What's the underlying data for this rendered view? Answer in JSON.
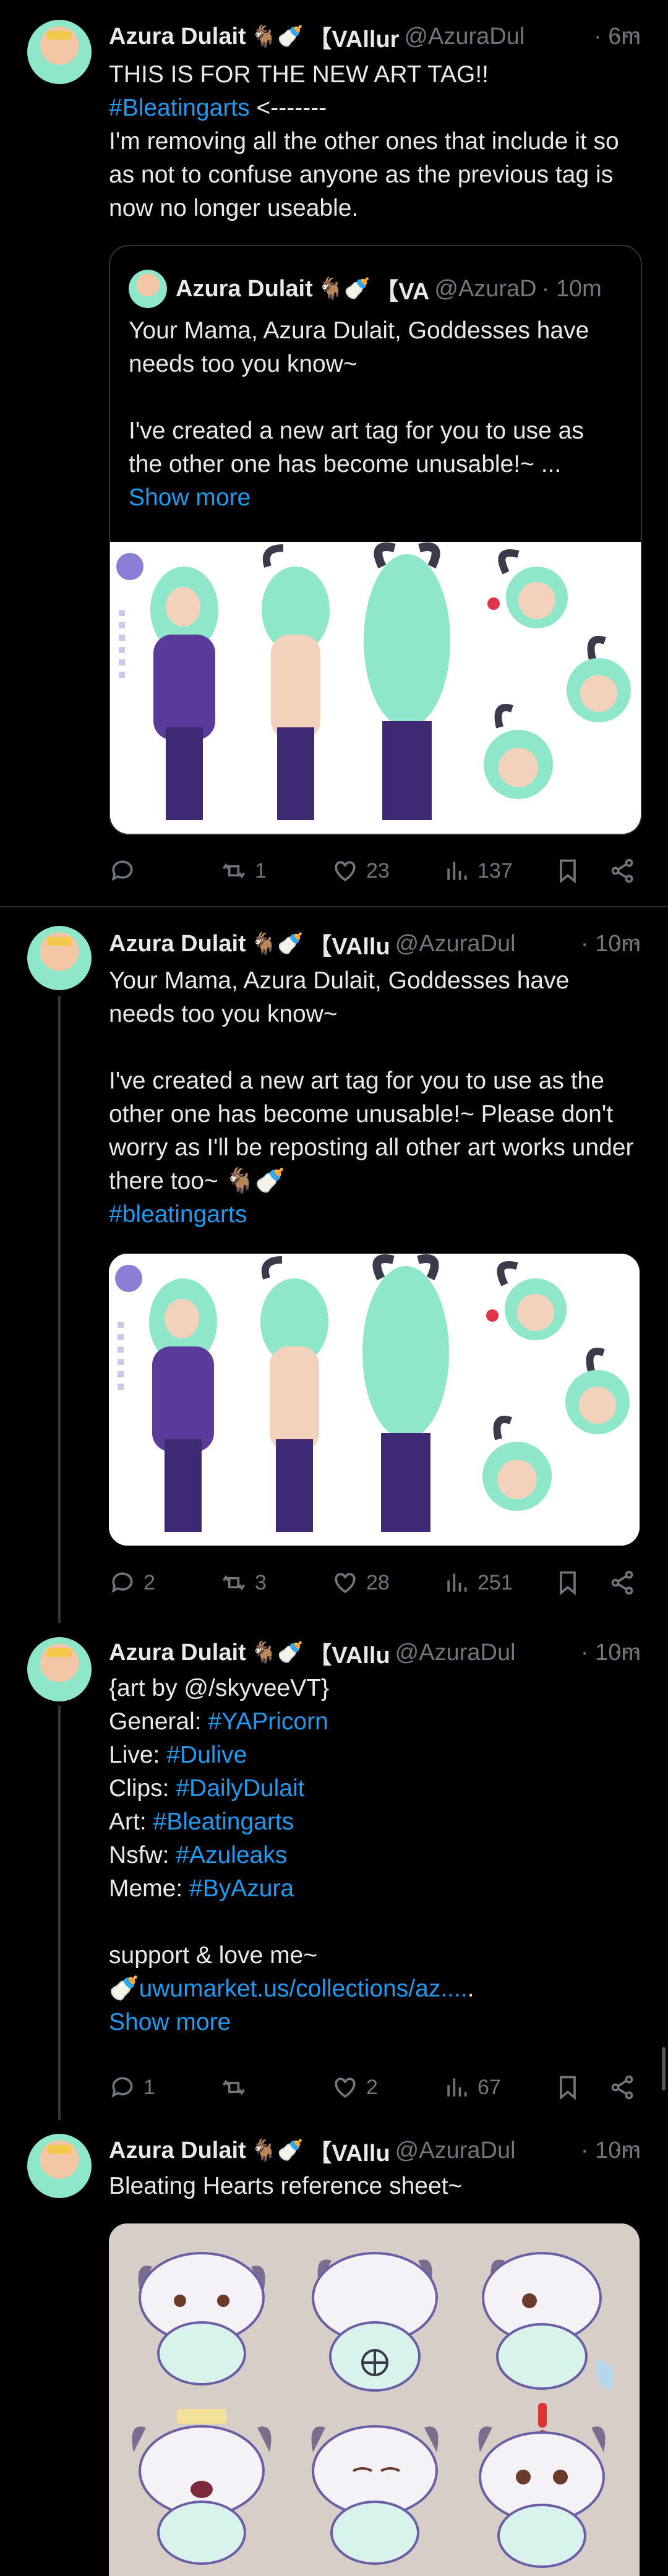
{
  "tweets": [
    {
      "name": "Azura Dulait",
      "emoji": "🐐🍼",
      "tag": "【VAllur",
      "handle": "@AzuraDul",
      "time": "· 6m",
      "lines": [
        "THIS IS FOR THE NEW ART TAG!!"
      ],
      "hashtag": "#Bleatingarts",
      "after_hashtag": " <-------",
      "body": "I'm removing all the other ones that include it so as not to confuse anyone as the previous tag is now no longer useable.",
      "quote": {
        "name": "Azura Dulait",
        "emoji": "🐐🍼",
        "tag": "【VA",
        "handle": "@AzuraD",
        "time": "· 10m",
        "text1": "Your Mama, Azura Dulait, Goddesses have needs too you know~",
        "text2": "I've created a new art tag for you to use as the other one has become unusable!~ ...",
        "show_more": "Show more"
      },
      "stats": {
        "replies": "",
        "retweets": "1",
        "likes": "23",
        "views": "137"
      }
    },
    {
      "name": "Azura Dulait",
      "emoji": "🐐🍼",
      "tag": "【VAllu",
      "handle": "@AzuraDul",
      "time": "· 10m",
      "text1": "Your Mama, Azura Dulait, Goddesses have needs too you know~",
      "text2": "I've created a new art tag for you to use as the other one has become unusable!~ Please don't worry as I'll be reposting all other art works under there too~ 🐐🍼",
      "hashtag": "#bleatingarts",
      "stats": {
        "replies": "2",
        "retweets": "3",
        "likes": "28",
        "views": "251"
      }
    },
    {
      "name": "Azura Dulait",
      "emoji": "🐐🍼",
      "tag": "【VAllu",
      "handle": "@AzuraDul",
      "time": "· 10m",
      "line1": "{art by @/skyveeVT}",
      "rows": [
        {
          "label": "General: ",
          "tag": "#YAPricorn"
        },
        {
          "label": "Live: ",
          "tag": "#Dulive"
        },
        {
          "label": "Clips: ",
          "tag": "#DailyDulait"
        },
        {
          "label": "Art: ",
          "tag": "#Bleatingarts"
        },
        {
          "label": "Nsfw: ",
          "tag": "#Azuleaks"
        },
        {
          "label": "Meme: ",
          "tag": "#ByAzura"
        }
      ],
      "support": "support & love me~",
      "link_emoji": "🍼",
      "link": "uwumarket.us/collections/az....",
      "link_tail": ".",
      "show_more": "Show more",
      "stats": {
        "replies": "1",
        "retweets": "",
        "likes": "2",
        "views": "67"
      }
    },
    {
      "name": "Azura Dulait",
      "emoji": "🐐🍼",
      "tag": "【VAllu",
      "handle": "@AzuraDul",
      "time": "· 10m",
      "text": "Bleating Hearts reference sheet~"
    }
  ],
  "more_icon": "···",
  "colors": {
    "accent": "#1d9bf0",
    "muted": "#71767b",
    "border": "#2f3336",
    "bg": "#000000"
  }
}
